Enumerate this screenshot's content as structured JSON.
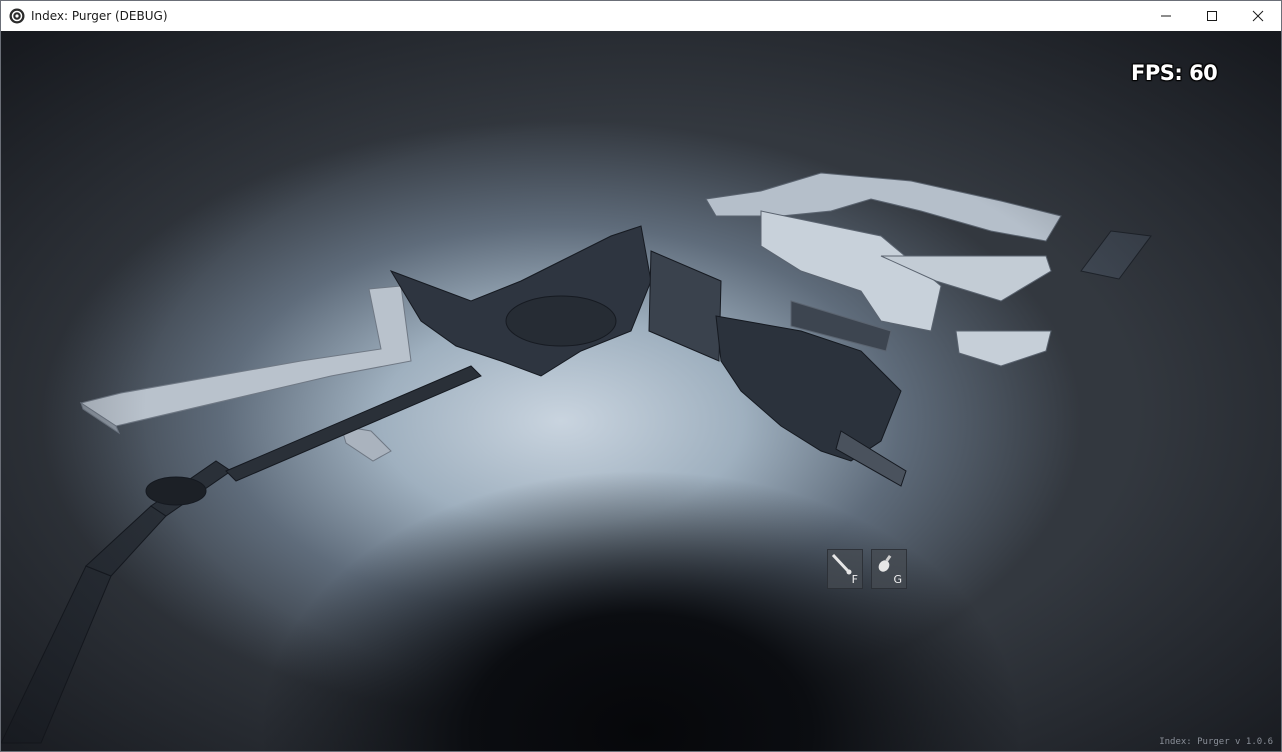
{
  "window": {
    "title": "Index: Purger (DEBUG)",
    "app_icon": "unity-icon",
    "controls": [
      {
        "name": "minimize-button",
        "icon": "minimize-icon"
      },
      {
        "name": "maximize-button",
        "icon": "maximize-icon"
      },
      {
        "name": "close-button",
        "icon": "close-icon"
      }
    ]
  },
  "hud": {
    "fps_text": "FPS: 60",
    "tool_slots": [
      {
        "key": "F",
        "icon": "flashlight-icon"
      },
      {
        "key": "G",
        "icon": "grenade-icon"
      }
    ]
  },
  "version_text": "Index: Purger v 1.0.6"
}
